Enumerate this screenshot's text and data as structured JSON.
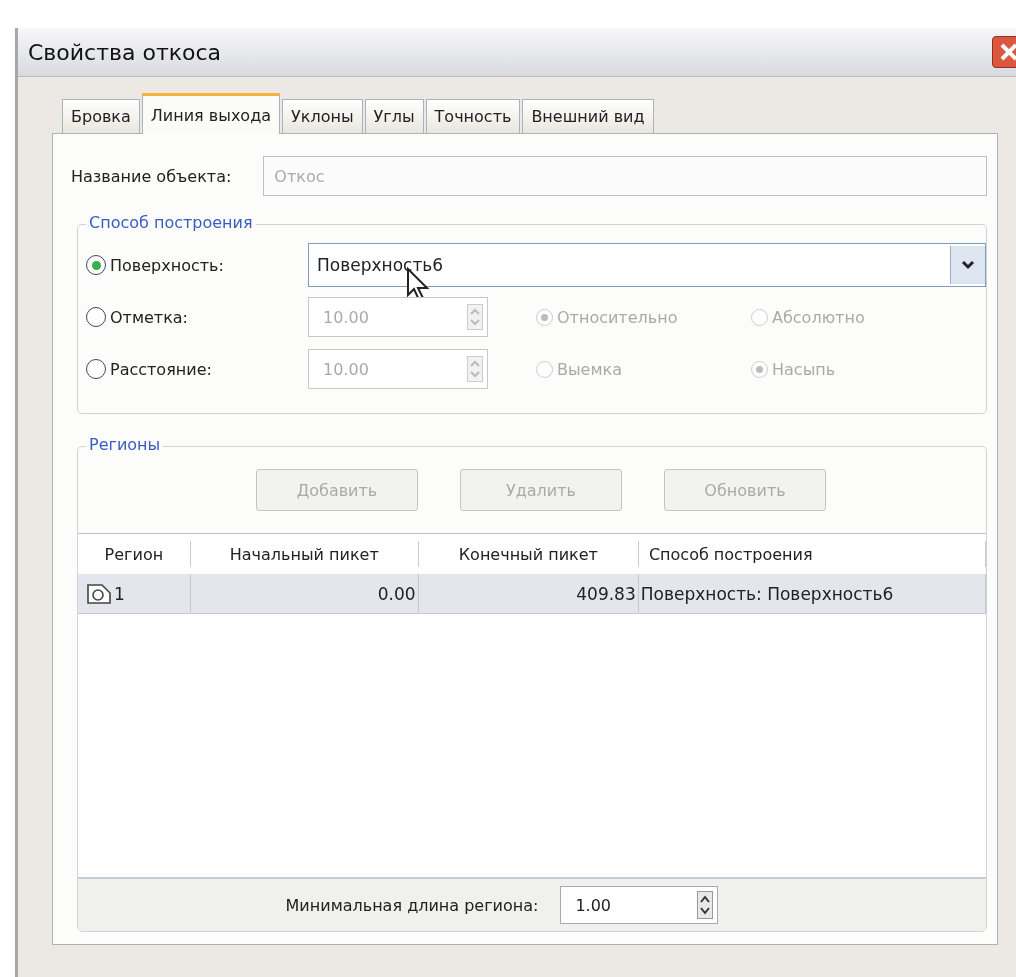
{
  "window": {
    "title": "Свойства откоса"
  },
  "tabs": [
    {
      "label": "Бровка",
      "selected": false
    },
    {
      "label": "Линия выхода",
      "selected": true
    },
    {
      "label": "Уклоны",
      "selected": false
    },
    {
      "label": "Углы",
      "selected": false
    },
    {
      "label": "Точность",
      "selected": false
    },
    {
      "label": "Внешний вид",
      "selected": false
    }
  ],
  "object_name": {
    "label": "Название объекта:",
    "value": "Откос",
    "disabled": true
  },
  "construction_method": {
    "legend": "Способ построения",
    "options": [
      {
        "kind": "combo",
        "label": "Поверхность:",
        "selected": true,
        "value": "Поверхность6",
        "disabled": false
      },
      {
        "kind": "spin",
        "label": "Отметка:",
        "selected": false,
        "value": "10.00",
        "disabled": true,
        "radios": [
          {
            "label": "Относительно",
            "selected": true
          },
          {
            "label": "Абсолютно",
            "selected": false
          }
        ]
      },
      {
        "kind": "spin",
        "label": "Расстояние:",
        "selected": false,
        "value": "10.00",
        "disabled": true,
        "radios": [
          {
            "label": "Выемка",
            "selected": false
          },
          {
            "label": "Насыпь",
            "selected": true
          }
        ]
      }
    ]
  },
  "regions": {
    "legend": "Регионы",
    "buttons": [
      {
        "label": "Добавить",
        "disabled": true
      },
      {
        "label": "Удалить",
        "disabled": true
      },
      {
        "label": "Обновить",
        "disabled": true
      }
    ],
    "table": {
      "columns": [
        "Регион",
        "Начальный пикет",
        "Конечный пикет",
        "Способ построения"
      ],
      "rows": [
        {
          "cells": [
            "1",
            "0.00",
            "409.83",
            "Поверхность: Поверхность6"
          ],
          "selected": true
        }
      ]
    },
    "min_length": {
      "label": "Минимальная длина региона:",
      "value": "1.00"
    }
  }
}
